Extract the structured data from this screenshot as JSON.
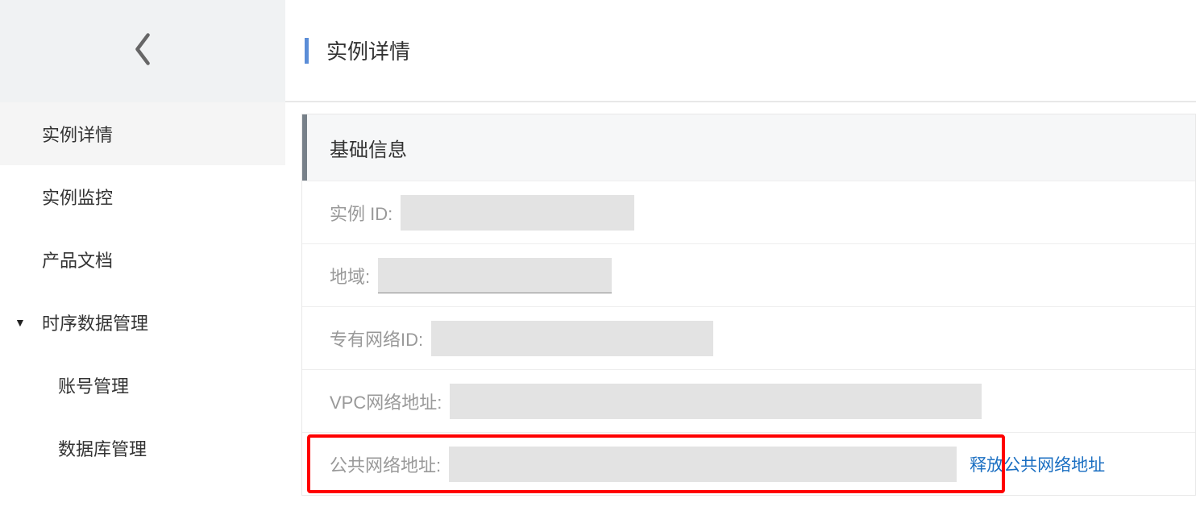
{
  "sidebar": {
    "items": [
      {
        "label": "实例详情"
      },
      {
        "label": "实例监控"
      },
      {
        "label": "产品文档"
      },
      {
        "label": "时序数据管理",
        "expanded": true
      }
    ],
    "subitems": [
      {
        "label": "账号管理"
      },
      {
        "label": "数据库管理"
      }
    ]
  },
  "header": {
    "title": "实例详情"
  },
  "panel": {
    "title": "基础信息",
    "rows": {
      "instance_id_label": "实例 ID:",
      "region_label": "地域:",
      "vpc_id_label": "专有网络ID:",
      "vpc_addr_label": "VPC网络地址:",
      "public_addr_label": "公共网络地址:"
    },
    "release_link": "释放公共网络地址"
  }
}
